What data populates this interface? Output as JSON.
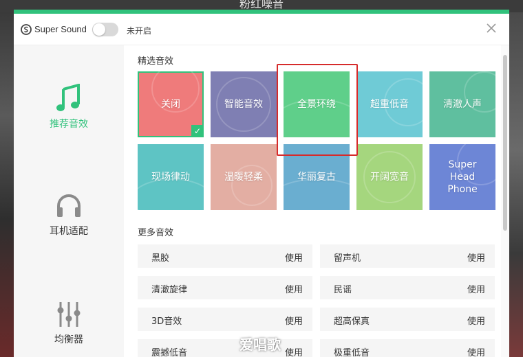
{
  "window": {
    "title": "粉红噪音"
  },
  "header": {
    "brand": "Super Sound",
    "toggle_label": "未开启"
  },
  "sidebar": {
    "items": [
      {
        "label": "推荐音效",
        "icon": "music-note-icon",
        "active": true
      },
      {
        "label": "耳机适配",
        "icon": "headphones-icon",
        "active": false
      },
      {
        "label": "均衡器",
        "icon": "equalizer-icon",
        "active": false
      }
    ]
  },
  "featured": {
    "title": "精选音效",
    "tiles": [
      {
        "label": "关闭",
        "color": "#ef7b7b",
        "selected": true
      },
      {
        "label": "智能音效",
        "color": "#7f7fb3",
        "selected": false
      },
      {
        "label": "全景环绕",
        "color": "#5fcf8a",
        "selected": false
      },
      {
        "label": "超重低音",
        "color": "#6fcbd6",
        "selected": false
      },
      {
        "label": "清澈人声",
        "color": "#5fbf9f",
        "selected": false
      },
      {
        "label": "现场律动",
        "color": "#5ec4c4",
        "selected": false
      },
      {
        "label": "温暖轻柔",
        "color": "#e3aea3",
        "selected": false
      },
      {
        "label": "华丽复古",
        "color": "#6aaed0",
        "selected": false
      },
      {
        "label": "开阔宽音",
        "color": "#a5d67e",
        "selected": false
      },
      {
        "label": "Super Head Phone",
        "color": "#6d86d6",
        "selected": false
      }
    ]
  },
  "more": {
    "title": "更多音效",
    "use_label": "使用",
    "rows": [
      {
        "name": "黑胶"
      },
      {
        "name": "留声机"
      },
      {
        "name": "清澈旋律"
      },
      {
        "name": "民谣"
      },
      {
        "name": "3D音效"
      },
      {
        "name": "超高保真"
      },
      {
        "name": "震撼低音"
      },
      {
        "name": "极重低音"
      }
    ]
  },
  "watermark": "爱唱歌",
  "colors": {
    "accent": "#31c27c",
    "highlight_box": "#d62b2b"
  }
}
